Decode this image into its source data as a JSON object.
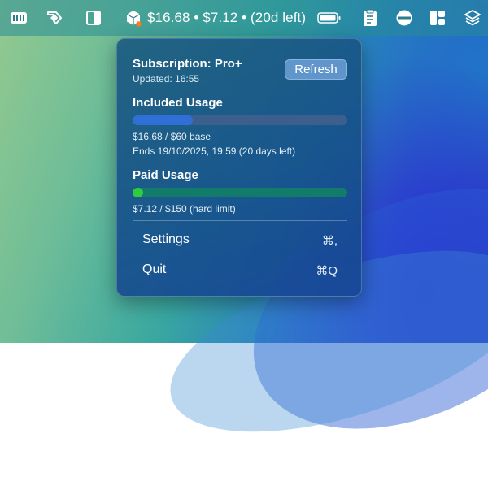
{
  "menubar": {
    "status_text": "$16.68 • $7.12 • (20d left)",
    "icons": [
      "keyboard-icon",
      "tag-icon",
      "sidebar-icon",
      "cube-app-icon",
      "battery-icon",
      "clipboard-icon",
      "stop-circle-icon",
      "grid-layout-icon",
      "layers-icon"
    ],
    "status_dot_color": "#ff7b1c"
  },
  "popover": {
    "subscription_title": "Subscription: Pro+",
    "updated": "Updated: 16:55",
    "refresh_label": "Refresh",
    "included": {
      "title": "Included Usage",
      "progress": 0.28,
      "amount": "$16.68 / $60 base",
      "ends": "Ends 19/10/2025, 19:59 (20 days left)",
      "bar_color": "#2f6fd6",
      "track_color": "#3d5f8e"
    },
    "paid": {
      "title": "Paid Usage",
      "progress": 0.05,
      "amount": "$7.12 / $150 (hard limit)",
      "bar_color": "#2ecc40",
      "track_color": "#137b6a"
    },
    "menu": [
      {
        "label": "Settings",
        "shortcut": "⌘,"
      },
      {
        "label": "Quit",
        "shortcut": "⌘Q"
      }
    ]
  }
}
